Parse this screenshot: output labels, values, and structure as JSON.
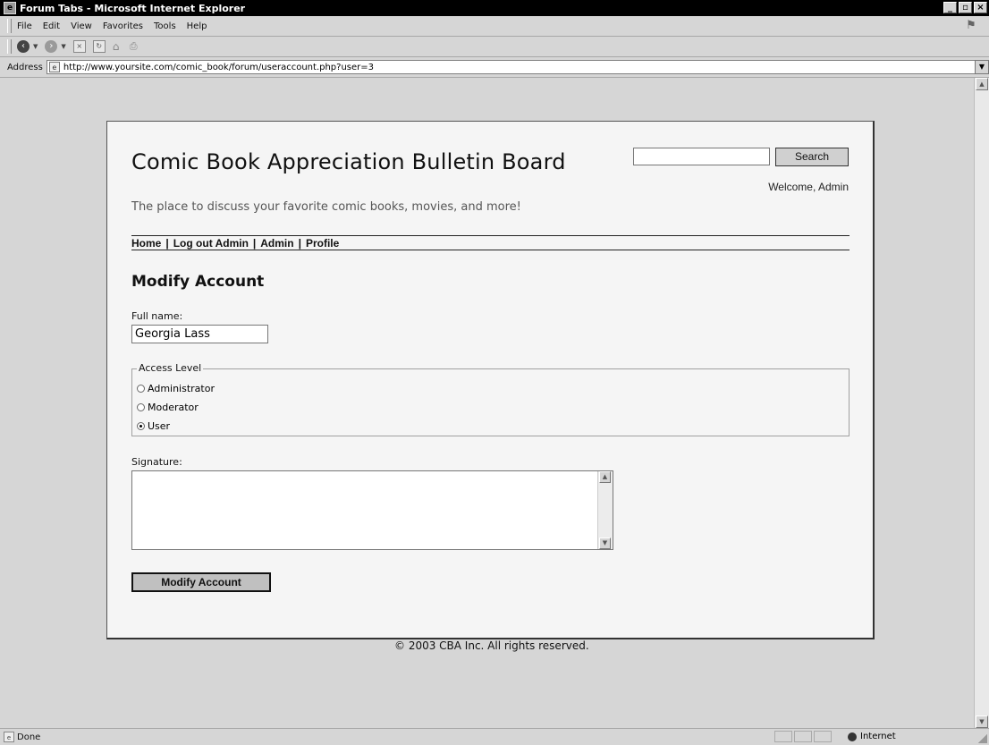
{
  "window": {
    "title": "Forum Tabs - Microsoft Internet Explorer"
  },
  "menu": [
    "File",
    "Edit",
    "View",
    "Favorites",
    "Tools",
    "Help"
  ],
  "address": {
    "label": "Address",
    "url": "http://www.yoursite.com/comic_book/forum/useraccount.php?user=3"
  },
  "site": {
    "title": "Comic Book Appreciation Bulletin Board",
    "tagline": "The place to discuss your favorite comic books, movies, and more!",
    "search_button": "Search",
    "search_value": "",
    "welcome": "Welcome, Admin"
  },
  "nav": [
    "Home",
    "Log out Admin",
    "Admin",
    "Profile"
  ],
  "form": {
    "heading": "Modify Account",
    "fullname_label": "Full name:",
    "fullname_value": "Georgia Lass",
    "access_legend": "Access Level",
    "access_options": [
      {
        "label": "Administrator",
        "checked": false
      },
      {
        "label": "Moderator",
        "checked": false
      },
      {
        "label": "User",
        "checked": true
      }
    ],
    "signature_label": "Signature:",
    "signature_value": "",
    "submit_label": "Modify Account"
  },
  "footer": "© 2003 CBA Inc. All rights reserved.",
  "status": {
    "text": "Done",
    "zone": "Internet"
  }
}
